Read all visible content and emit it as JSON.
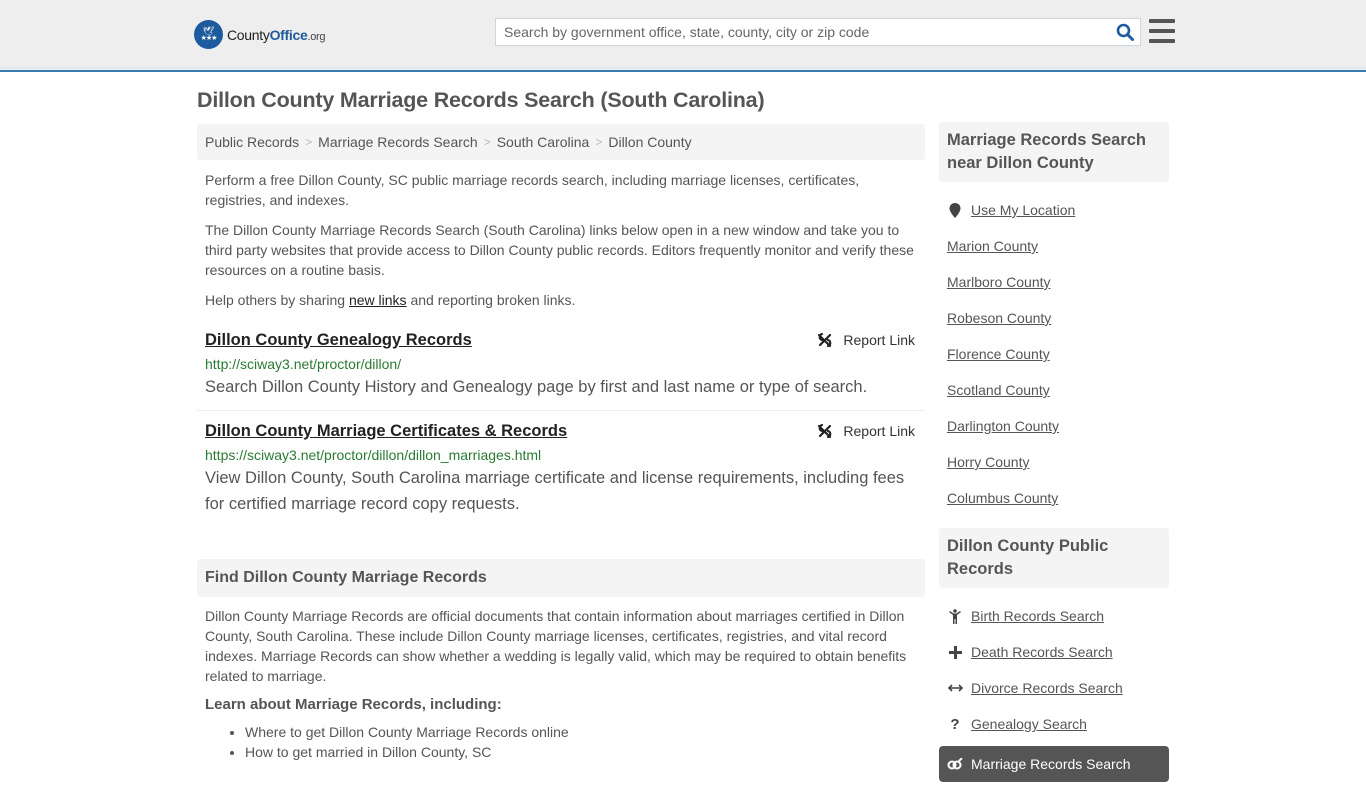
{
  "header": {
    "logo": {
      "name": "County",
      "accent": "Office",
      "tld": ".org"
    },
    "search": {
      "placeholder": "Search by government office, state, county, city or zip code",
      "value": ""
    },
    "brand_color": "#1e5a9e"
  },
  "page": {
    "title": "Dillon County Marriage Records Search (South Carolina)",
    "breadcrumb": [
      "Public Records",
      "Marriage Records Search",
      "South Carolina",
      "Dillon County"
    ],
    "intro": {
      "p1": "Perform a free Dillon County, SC public marriage records search, including marriage licenses, certificates, registries, and indexes.",
      "p2": "The Dillon County Marriage Records Search (South Carolina) links below open in a new window and take you to third party websites that provide access to Dillon County public records. Editors frequently monitor and verify these resources on a routine basis.",
      "p3_before": "Help others by sharing ",
      "p3_link": "new links",
      "p3_after": " and reporting broken links."
    },
    "links": [
      {
        "title": "Dillon County Genealogy Records",
        "url": "http://sciway3.net/proctor/dillon/",
        "description": "Search Dillon County History and Genealogy page by first and last name or type of search.",
        "report_label": "Report Link"
      },
      {
        "title": "Dillon County Marriage Certificates & Records",
        "url": "https://sciway3.net/proctor/dillon/dillon_marriages.html",
        "description": "View Dillon County, South Carolina marriage certificate and license requirements, including fees for certified marriage record copy requests.",
        "report_label": "Report Link"
      }
    ],
    "find": {
      "heading": "Find Dillon County Marriage Records",
      "body": "Dillon County Marriage Records are official documents that contain information about marriages certified in Dillon County, South Carolina. These include Dillon County marriage licenses, certificates, registries, and vital record indexes. Marriage Records can show whether a wedding is legally valid, which may be required to obtain benefits related to marriage.",
      "learn_heading": "Learn about Marriage Records, including:",
      "learn_items": [
        "Where to get Dillon County Marriage Records online",
        "How to get married in Dillon County, SC"
      ]
    }
  },
  "sidebar": {
    "nearby": {
      "heading": "Marriage Records Search near Dillon County",
      "use_location": "Use My Location",
      "counties": [
        "Marion County",
        "Marlboro County",
        "Robeson County",
        "Florence County",
        "Scotland County",
        "Darlington County",
        "Horry County",
        "Columbus County"
      ]
    },
    "public_records": {
      "heading": "Dillon County Public Records",
      "items": [
        {
          "label": "Birth Records Search",
          "icon": "child-icon"
        },
        {
          "label": "Death Records Search",
          "icon": "plus-icon"
        },
        {
          "label": "Divorce Records Search",
          "icon": "arrows-horizontal-icon"
        },
        {
          "label": "Genealogy Search",
          "icon": "question-icon"
        },
        {
          "label": "Marriage Records Search",
          "icon": "marriage-icon",
          "active": true
        }
      ]
    }
  }
}
